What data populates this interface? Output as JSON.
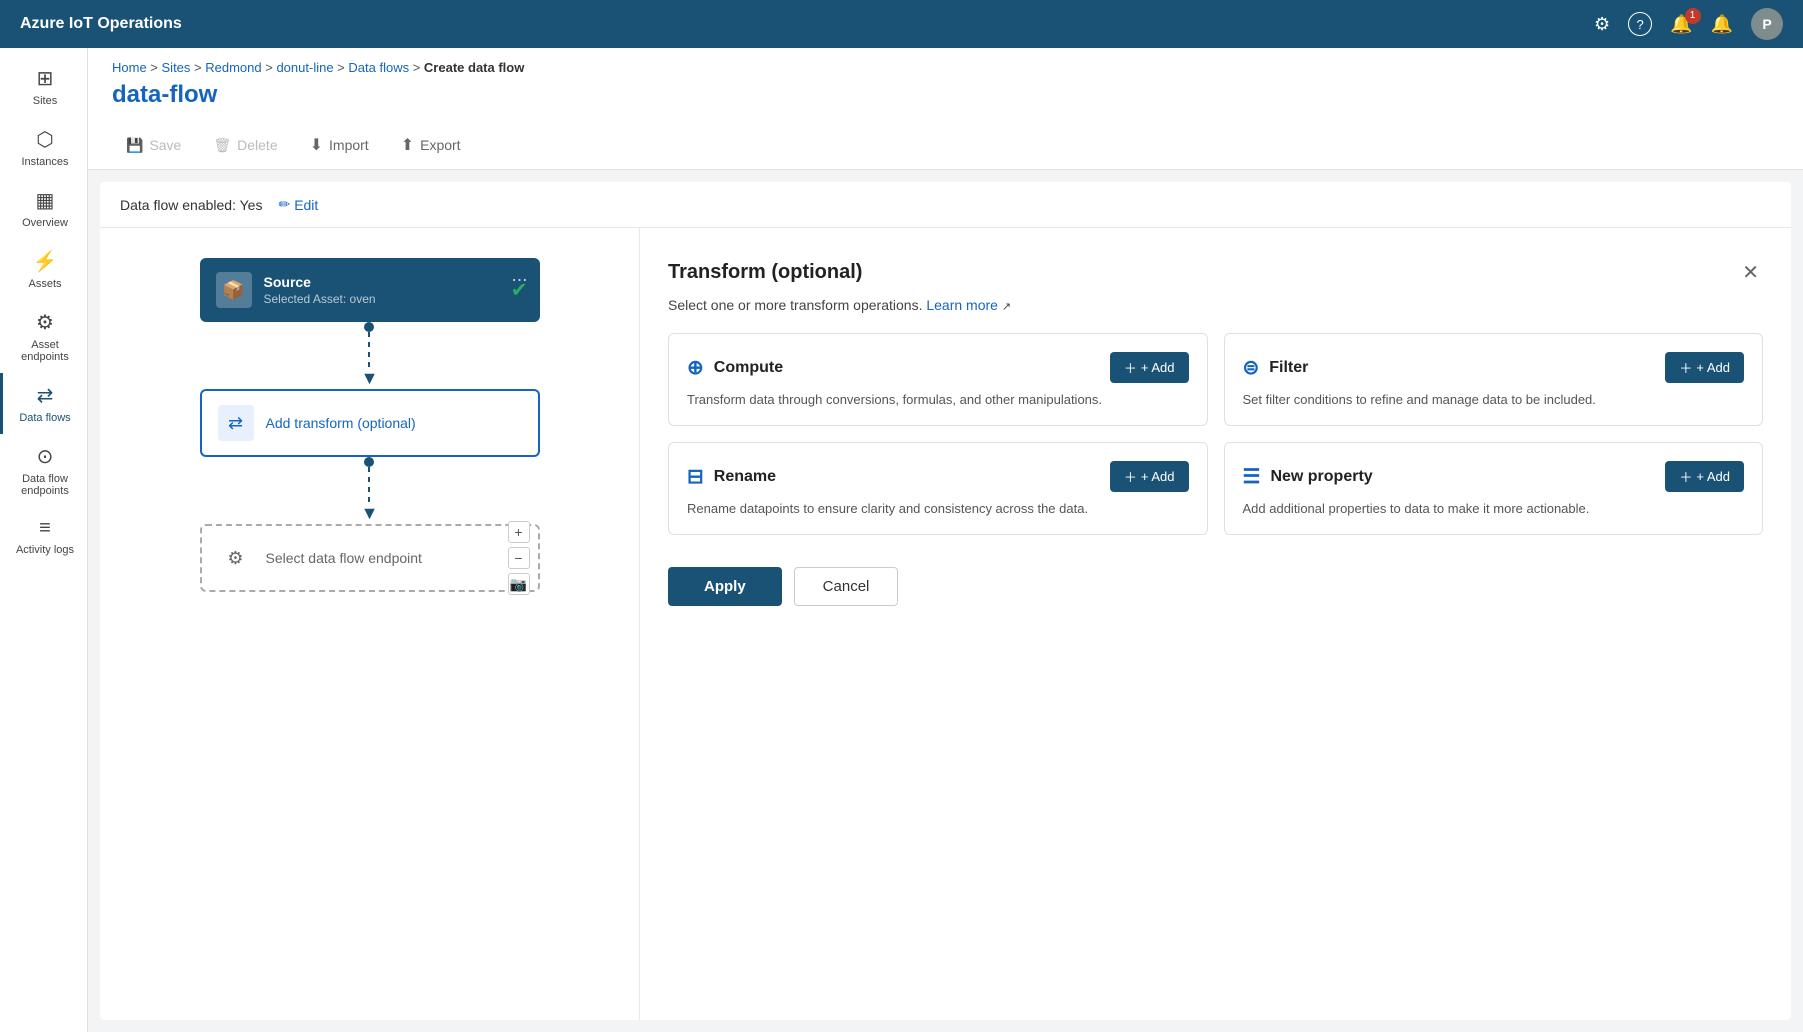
{
  "app": {
    "title": "Azure IoT Operations"
  },
  "topnav": {
    "settings_icon": "⚙",
    "help_icon": "?",
    "bell_icon": "🔔",
    "bell_badge": "1",
    "alert_icon": "🔔",
    "avatar_label": "P"
  },
  "sidebar": {
    "items": [
      {
        "id": "sites",
        "label": "Sites",
        "icon": "⊞"
      },
      {
        "id": "instances",
        "label": "Instances",
        "icon": "⬡"
      },
      {
        "id": "overview",
        "label": "Overview",
        "icon": "▦"
      },
      {
        "id": "assets",
        "label": "Assets",
        "icon": "⚡"
      },
      {
        "id": "asset-endpoints",
        "label": "Asset endpoints",
        "icon": "⚙"
      },
      {
        "id": "data-flows",
        "label": "Data flows",
        "icon": "⇄",
        "active": true
      },
      {
        "id": "data-flow-endpoints",
        "label": "Data flow endpoints",
        "icon": "⊙"
      },
      {
        "id": "activity-logs",
        "label": "Activity logs",
        "icon": "≡"
      }
    ]
  },
  "breadcrumb": {
    "items": [
      "Home",
      "Sites",
      "Redmond",
      "donut-line",
      "Data flows"
    ],
    "current": "Create data flow"
  },
  "page": {
    "title": "data-flow"
  },
  "toolbar": {
    "save_label": "Save",
    "delete_label": "Delete",
    "import_label": "Import",
    "export_label": "Export"
  },
  "dataflow": {
    "enabled_label": "Data flow enabled: Yes",
    "edit_label": "Edit"
  },
  "flow": {
    "source": {
      "title": "Source",
      "subtitle": "Selected Asset: oven",
      "menu": "⋯"
    },
    "transform": {
      "label": "Add transform (optional)"
    },
    "endpoint": {
      "label": "Select data flow endpoint"
    }
  },
  "transform_panel": {
    "title": "Transform (optional)",
    "description": "Select one or more transform operations.",
    "learn_more": "Learn more",
    "cards": [
      {
        "id": "compute",
        "icon": "⊕",
        "name": "Compute",
        "add_label": "+ Add",
        "description": "Transform data through conversions, formulas, and other manipulations."
      },
      {
        "id": "filter",
        "icon": "⊜",
        "name": "Filter",
        "add_label": "+ Add",
        "description": "Set filter conditions to refine and manage data to be included."
      },
      {
        "id": "rename",
        "icon": "⊟",
        "name": "Rename",
        "add_label": "+ Add",
        "description": "Rename datapoints to ensure clarity and consistency across the data."
      },
      {
        "id": "new-property",
        "icon": "☰",
        "name": "New property",
        "add_label": "+ Add",
        "description": "Add additional properties to data to make it more actionable."
      }
    ],
    "apply_label": "Apply",
    "cancel_label": "Cancel"
  }
}
